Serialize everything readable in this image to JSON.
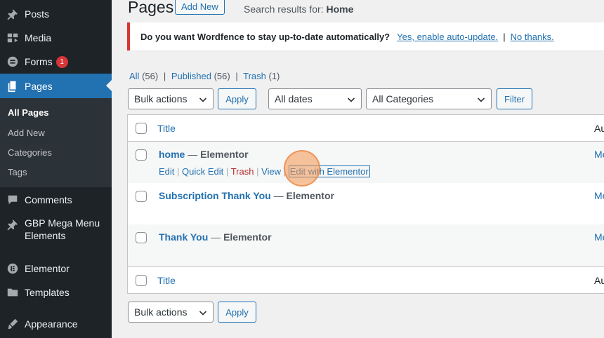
{
  "sidebar": {
    "items": [
      {
        "label": "Posts",
        "icon": "pin-icon"
      },
      {
        "label": "Media",
        "icon": "media-icon"
      },
      {
        "label": "Forms",
        "icon": "forms-icon",
        "badge": "1"
      },
      {
        "label": "Pages",
        "icon": "pages-icon"
      },
      {
        "label": "Comments",
        "icon": "comments-icon"
      },
      {
        "label": "GBP Mega Menu Elements",
        "icon": "pin-icon"
      },
      {
        "label": "Elementor",
        "icon": "elementor-icon"
      },
      {
        "label": "Templates",
        "icon": "folder-icon"
      },
      {
        "label": "Appearance",
        "icon": "brush-icon"
      }
    ],
    "submenu": [
      "All Pages",
      "Add New",
      "Categories",
      "Tags"
    ]
  },
  "header": {
    "title": "Pages",
    "add_new": "Add New",
    "search_prefix": "Search results for: ",
    "search_term": "Home"
  },
  "notice": {
    "text": "Do you want Wordfence to stay up-to-date automatically?",
    "link_yes": "Yes, enable auto-update.",
    "sep": "|",
    "link_no": "No thanks."
  },
  "views": {
    "all": "All",
    "all_count": "(56)",
    "published": "Published",
    "published_count": "(56)",
    "trash": "Trash",
    "trash_count": "(1)",
    "sep": "|"
  },
  "filters": {
    "bulk_actions": "Bulk actions",
    "apply": "Apply",
    "dates": "All dates",
    "categories": "All Categories",
    "filter": "Filter"
  },
  "table": {
    "col_title": "Title",
    "col_author": "Au",
    "rows": [
      {
        "title": "home",
        "dash": " — ",
        "state": "Elementor",
        "author": "Me"
      },
      {
        "title": "Subscription Thank You",
        "dash": " — ",
        "state": "Elementor",
        "author": "Me"
      },
      {
        "title": "Thank You",
        "dash": " — ",
        "state": "Elementor",
        "author": "Me"
      }
    ],
    "row_actions": {
      "edit": "Edit",
      "quick_edit": "Quick Edit",
      "trash": "Trash",
      "view": "View",
      "edit_elementor": "Edit with Elementor",
      "sep": "|"
    }
  },
  "bottom": {
    "bulk_actions": "Bulk actions",
    "apply": "Apply"
  }
}
